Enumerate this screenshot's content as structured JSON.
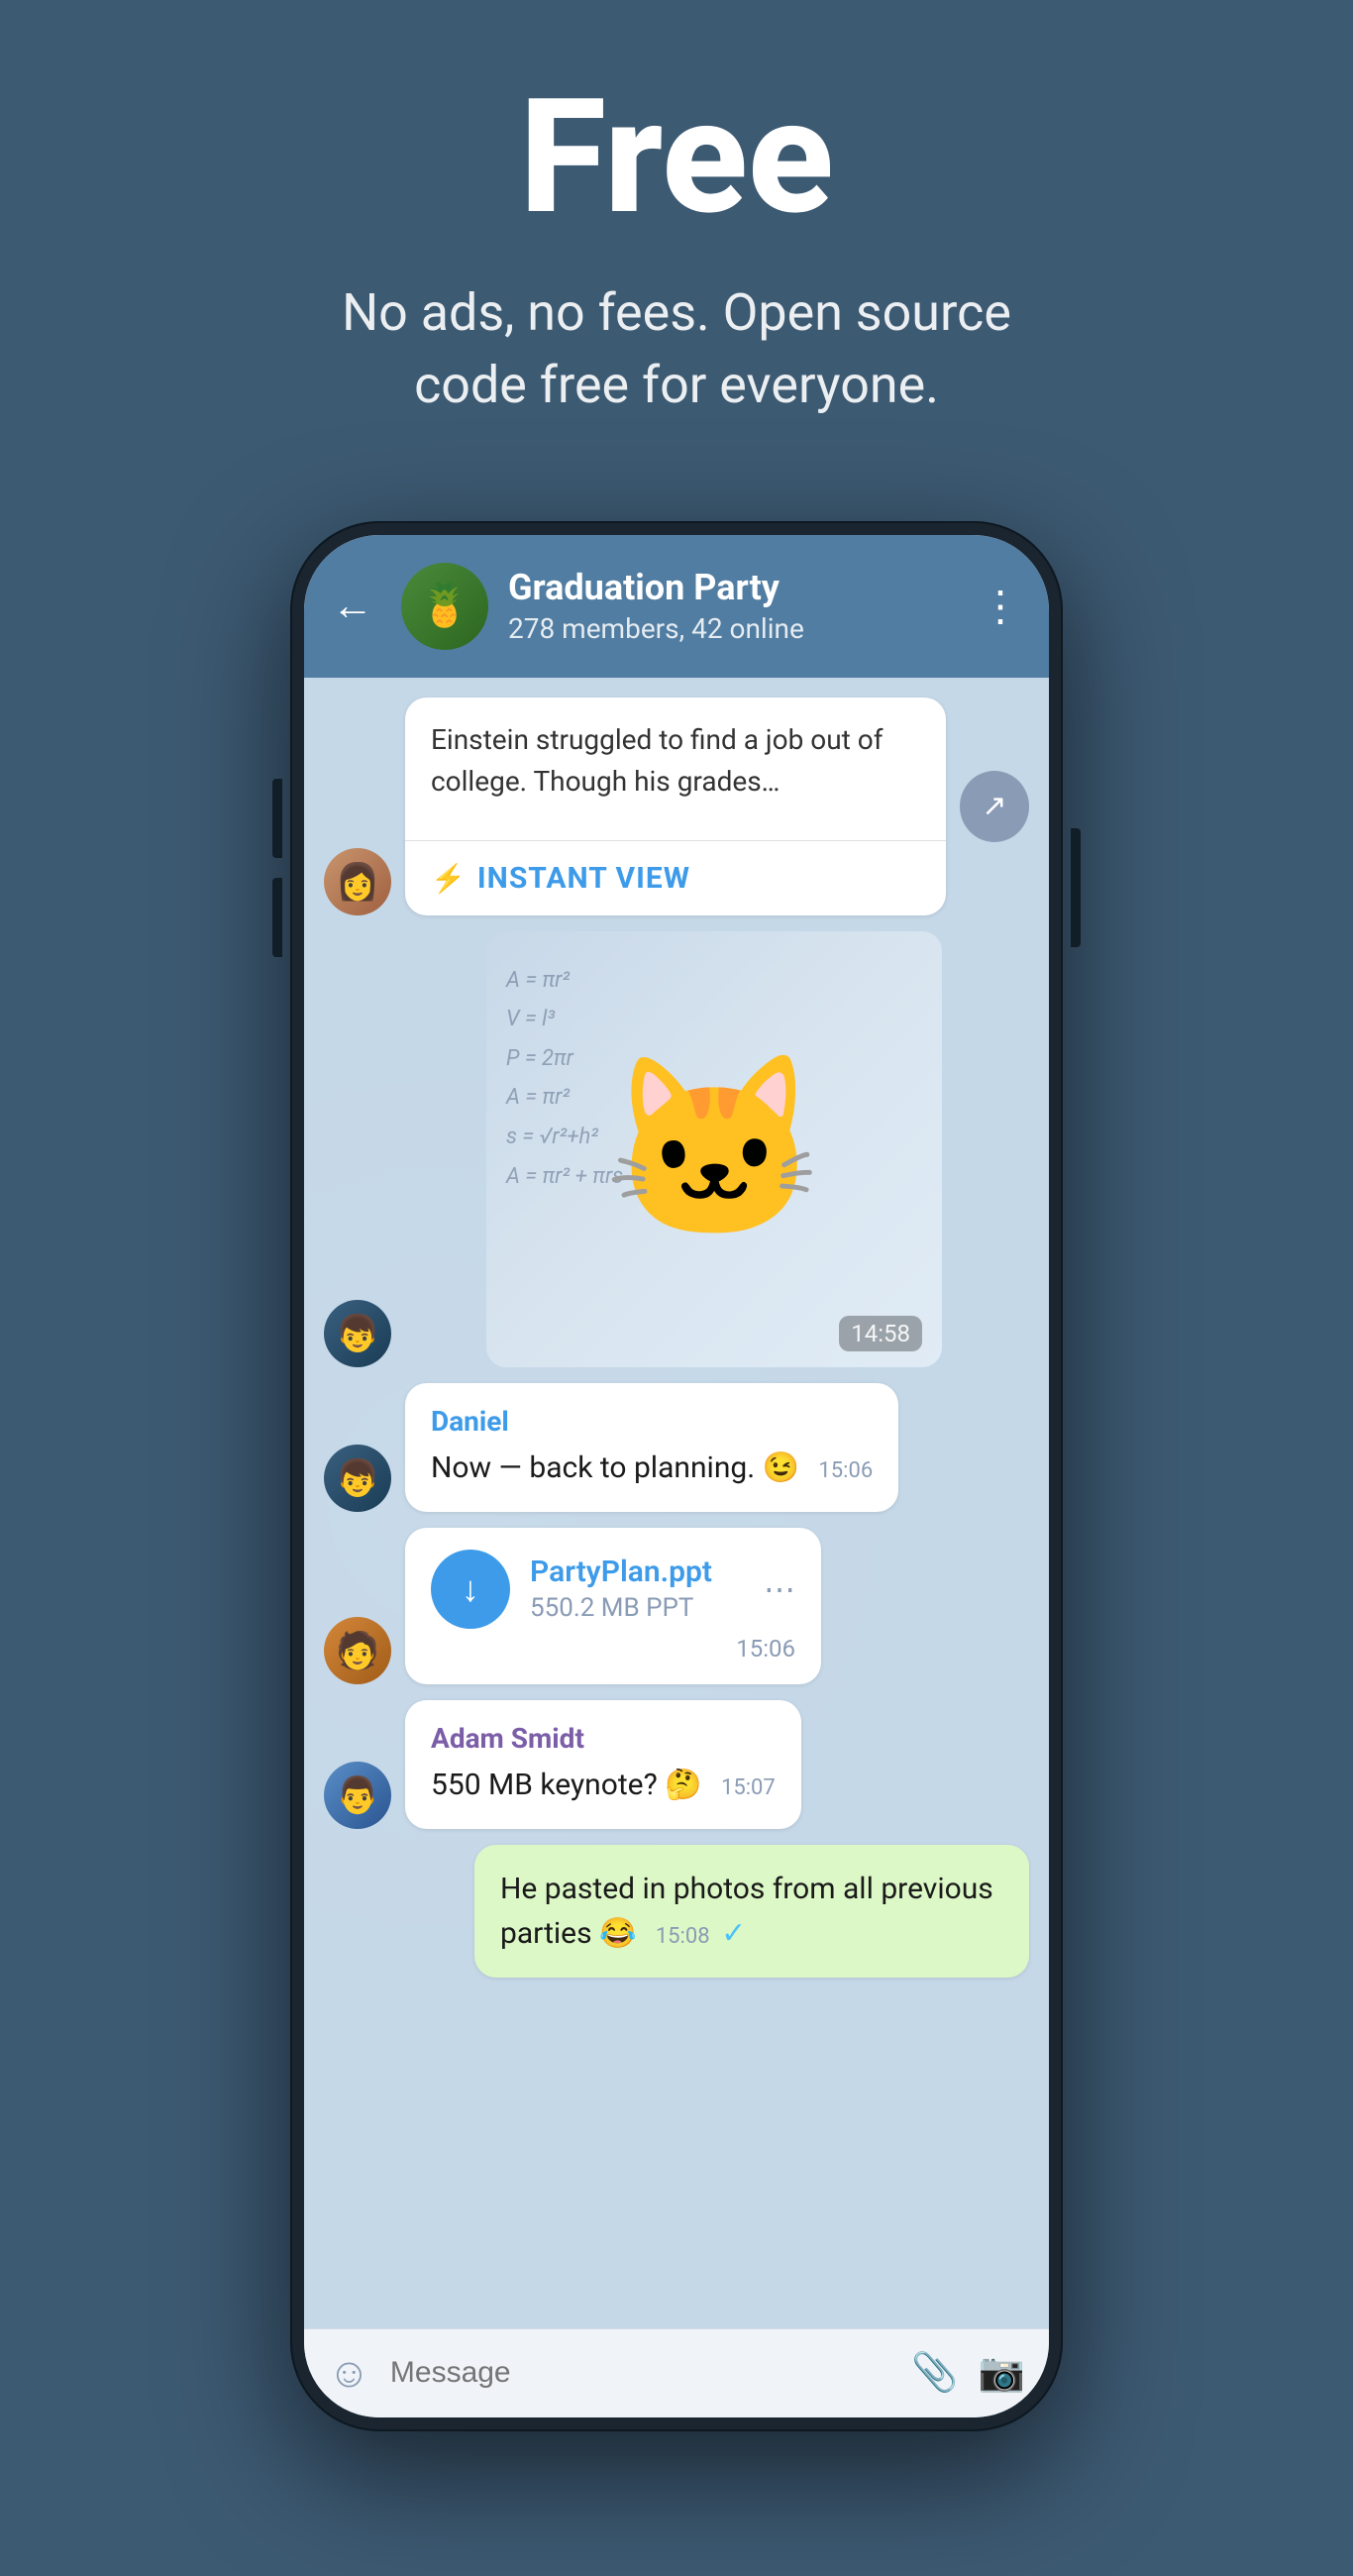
{
  "hero": {
    "title": "Free",
    "subtitle": "No ads, no fees. Open source code free for everyone."
  },
  "chat": {
    "back_label": "←",
    "group_name": "Graduation Party",
    "group_status": "278 members, 42 online",
    "more_icon": "⋮",
    "avatars": {
      "group": "🍍",
      "female": "👩",
      "hoodie": "👦",
      "glasses": "🧑",
      "blue_hat": "👨"
    },
    "messages": [
      {
        "id": "link_preview",
        "type": "link",
        "text": "Einstein struggled to find a job out of college. Though his grades…",
        "instant_view_label": "INSTANT VIEW",
        "iv_icon": "⚡"
      },
      {
        "id": "sticker",
        "type": "sticker",
        "time": "14:58"
      },
      {
        "id": "daniel_msg",
        "sender": "Daniel",
        "type": "text",
        "text": "Now — back to planning. 😉",
        "time": "15:06"
      },
      {
        "id": "file_msg",
        "type": "file",
        "filename": "PartyPlan.ppt",
        "filesize": "550.2 MB PPT",
        "time": "15:06"
      },
      {
        "id": "adam_msg",
        "sender": "Adam Smidt",
        "type": "text",
        "text": "550 MB keynote? 🤔",
        "time": "15:07"
      },
      {
        "id": "self_msg",
        "type": "self",
        "text": "He pasted in photos from all previous parties 😂",
        "time": "15:08",
        "read": true
      }
    ]
  },
  "input_bar": {
    "placeholder": "Message"
  },
  "icons": {
    "back": "←",
    "more": "⋮",
    "share": "↗",
    "download": "↓",
    "emoji": "☺",
    "attach": "📎",
    "camera": "📷"
  }
}
